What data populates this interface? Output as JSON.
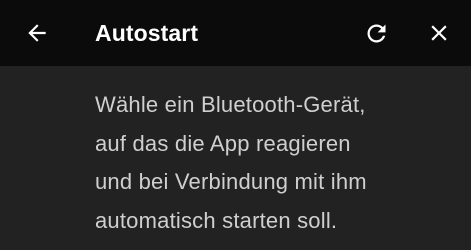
{
  "app_bar": {
    "title": "Autostart",
    "back_icon": "arrow-back-icon",
    "refresh_icon": "refresh-icon",
    "close_icon": "close-icon"
  },
  "description": {
    "lines": [
      "Wähle ein Bluetooth-Gerät,",
      "auf das die App reagieren",
      "und bei Verbindung mit ihm",
      "automatisch starten soll."
    ]
  },
  "colors": {
    "app_bar_background": "#0b0b0b",
    "background": "#222222",
    "title_text": "#ffffff",
    "body_text": "#cfcfcf"
  }
}
